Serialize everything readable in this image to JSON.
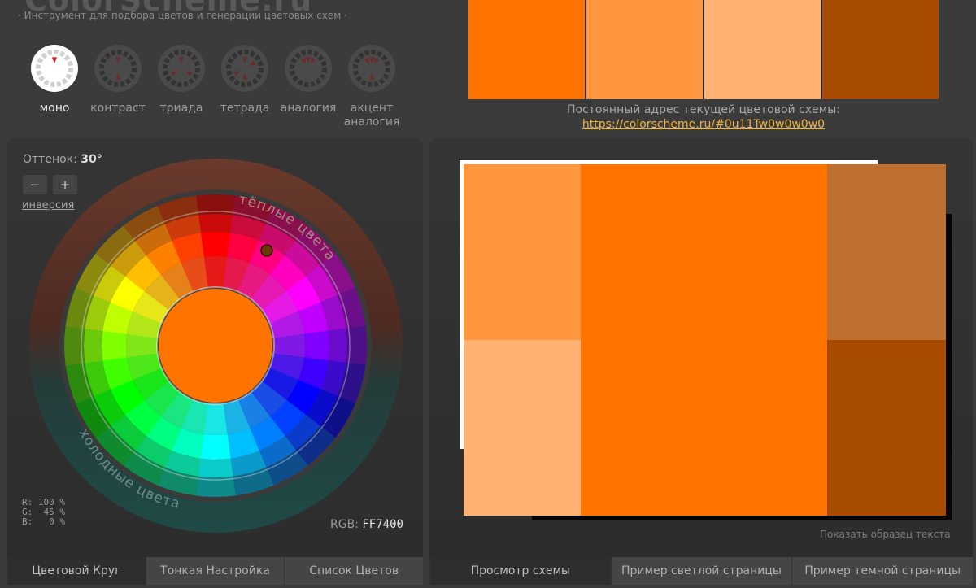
{
  "header": {
    "logo": "ColorScheme.ru",
    "tagline": "· Инструмент для подбора цветов и генерации цветовых схем ·",
    "modes": [
      {
        "id": "mono",
        "label": "моно",
        "active": true,
        "icon": "mono-mode-icon"
      },
      {
        "id": "contrast",
        "label": "контраст",
        "active": false,
        "icon": "contrast-mode-icon"
      },
      {
        "id": "triad",
        "label": "триада",
        "active": false,
        "icon": "triad-mode-icon"
      },
      {
        "id": "tetrad",
        "label": "тетрада",
        "active": false,
        "icon": "tetrad-mode-icon"
      },
      {
        "id": "analog",
        "label": "аналогия",
        "active": false,
        "icon": "analog-mode-icon"
      },
      {
        "id": "accent-analog",
        "label": "акцент аналогия",
        "active": false,
        "icon": "accent-analog-mode-icon"
      }
    ]
  },
  "scheme": {
    "swatches": [
      "#FF7400",
      "#FF9640",
      "#FFB273",
      "#A64B00"
    ],
    "permalink_label": "Постоянный адрес текущей цветовой схемы:",
    "permalink_url": "https://colorscheme.ru/#0u11Tw0w0w0w0"
  },
  "wheel": {
    "hue_label": "Оттенок:",
    "hue_value": "30°",
    "minus_label": "−",
    "plus_label": "+",
    "inversion_label": "инверсия",
    "warm_label": "тёплые цвета",
    "cold_label": "холодные цвета",
    "center_color": "#FF7400",
    "rgb_values": "R: 100 %\nG:  45 %\nB:   0 %",
    "rgb_label": "RGB:",
    "rgb_hex": "FF7400"
  },
  "left_tabs": [
    {
      "label": "Цветовой Круг",
      "active": true
    },
    {
      "label": "Тонкая Настройка",
      "active": false
    },
    {
      "label": "Список Цветов",
      "active": false
    }
  ],
  "preview": {
    "colors": {
      "main": "#FF7400",
      "light_1": "#FF9640",
      "light_2": "#FFB273",
      "dark_1": "#BF7030",
      "dark_2": "#A64B00"
    },
    "show_text_label": "Показать образец текста"
  },
  "right_tabs": [
    {
      "label": "Просмотр схемы",
      "active": true
    },
    {
      "label": "Пример светлой страницы",
      "active": false
    },
    {
      "label": "Пример темной страницы",
      "active": false
    }
  ]
}
